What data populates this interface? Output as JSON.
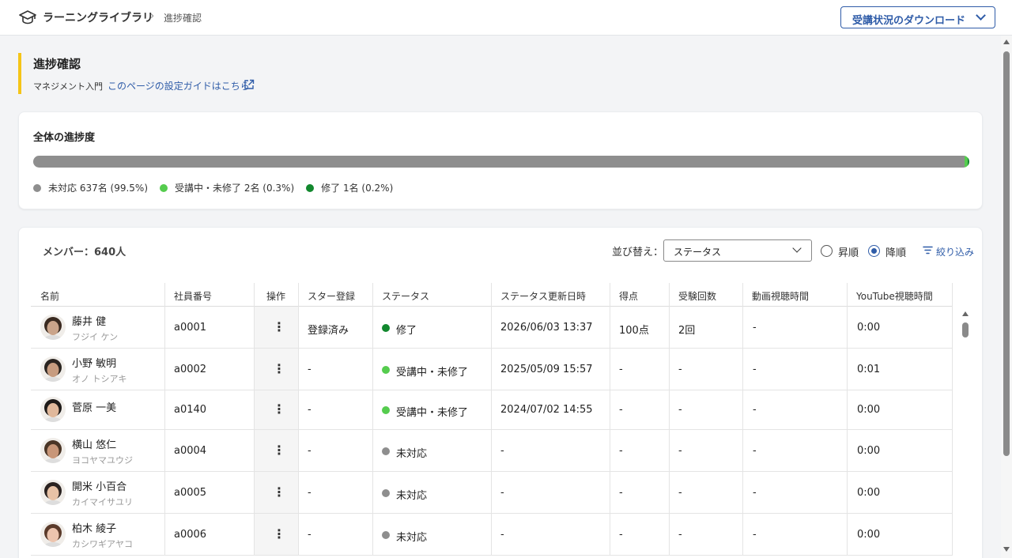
{
  "header": {
    "brand": "ラーニングライブラリ",
    "breadcrumb_sep": "›",
    "breadcrumb_current": "進捗確認",
    "download_label": "受講状況のダウンロード"
  },
  "title_section": {
    "title": "進捗確認",
    "course": "マネジメント入門",
    "guide_link": "このページの設定ガイドはこちら"
  },
  "progress": {
    "title": "全体の進捗度",
    "segments": [
      {
        "label": "未対応 637名 (99.5%)",
        "percent": 99.5,
        "color": "#8e8e8e"
      },
      {
        "label": "受講中・未修了 2名 (0.3%)",
        "percent": 0.3,
        "color": "#55cc4e"
      },
      {
        "label": "修了 1名 (0.2%)",
        "percent": 0.2,
        "color": "#12882e"
      }
    ]
  },
  "members": {
    "count": "メンバー：640人",
    "sort_label": "並び替え：",
    "sort_value": "ステータス",
    "asc_label": "昇順",
    "desc_label": "降順",
    "selected_order": "降順",
    "filter_label": "絞り込み"
  },
  "table": {
    "columns": [
      "名前",
      "社員番号",
      "操作",
      "スター登録",
      "ステータス",
      "ステータス更新日時",
      "得点",
      "受験回数",
      "動画視聴時間",
      "YouTube視聴時間"
    ],
    "rows": [
      {
        "name": "藤井 健",
        "kana": "フジイ ケン",
        "emp": "a0001",
        "star": "登録済み",
        "status": "修了",
        "status_color": "#12882e",
        "updated": "2026/06/03 13:37",
        "score": "100点",
        "attempts": "2回",
        "video": "-",
        "youtube": "0:00"
      },
      {
        "name": "小野 敏明",
        "kana": "オノ トシアキ",
        "emp": "a0002",
        "star": "-",
        "status": "受講中・未修了",
        "status_color": "#55cc4e",
        "updated": "2025/05/09 15:57",
        "score": "-",
        "attempts": "-",
        "video": "-",
        "youtube": "0:01"
      },
      {
        "name": "菅原 一美",
        "kana": "",
        "emp": "a0140",
        "star": "-",
        "status": "受講中・未修了",
        "status_color": "#55cc4e",
        "updated": "2024/07/02 14:55",
        "score": "-",
        "attempts": "-",
        "video": "-",
        "youtube": "0:00"
      },
      {
        "name": "横山 悠仁",
        "kana": "ヨコヤマユウジ",
        "emp": "a0004",
        "star": "-",
        "status": "未対応",
        "status_color": "#8e8e8e",
        "updated": "-",
        "score": "-",
        "attempts": "-",
        "video": "-",
        "youtube": "0:00"
      },
      {
        "name": "開米 小百合",
        "kana": "カイマイサユリ",
        "emp": "a0005",
        "star": "-",
        "status": "未対応",
        "status_color": "#8e8e8e",
        "updated": "-",
        "score": "-",
        "attempts": "-",
        "video": "-",
        "youtube": "0:00"
      },
      {
        "name": "柏木 綾子",
        "kana": "カシワギアヤコ",
        "emp": "a0006",
        "star": "-",
        "status": "未対応",
        "status_color": "#8e8e8e",
        "updated": "-",
        "score": "-",
        "attempts": "-",
        "video": "-",
        "youtube": "0:00"
      }
    ]
  },
  "colors": {
    "accent": "#2f5ca8",
    "title_bar": "#f5c518"
  },
  "icons": [
    "graduation-cap-icon",
    "chevron-down-icon",
    "external-link-icon",
    "filter-icon",
    "kebab-menu-icon"
  ]
}
